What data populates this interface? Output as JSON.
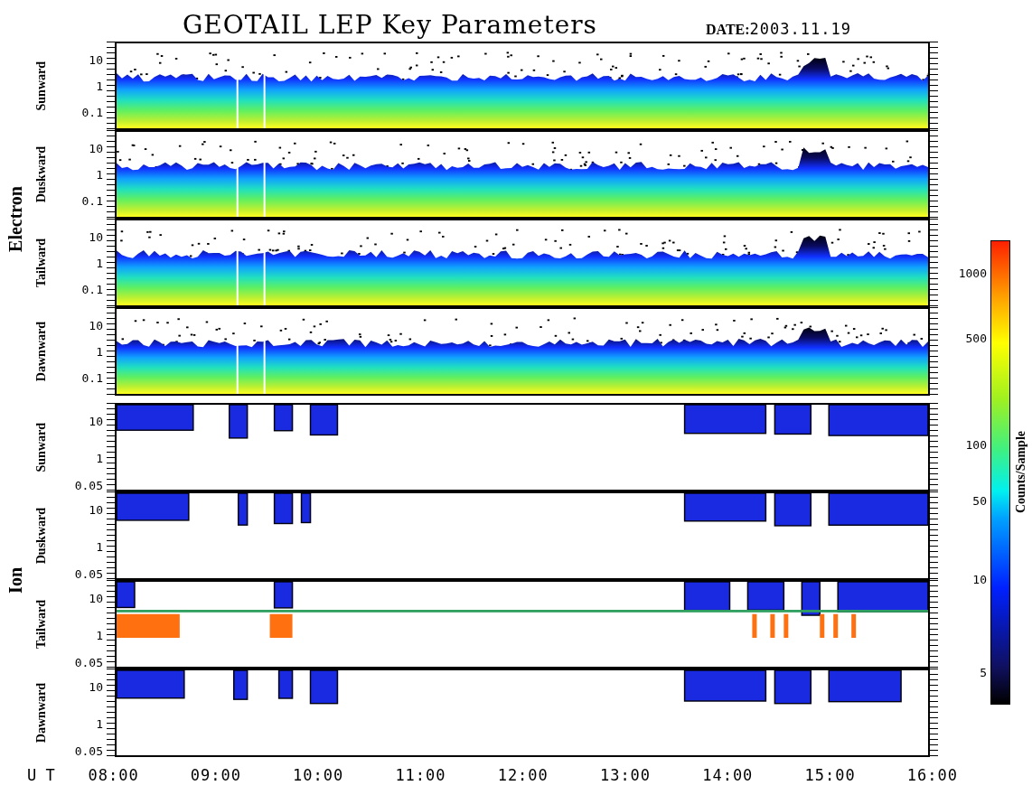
{
  "title": "GEOTAIL LEP Key Parameters",
  "date": {
    "label": "DATE:",
    "value": "2003.11.19"
  },
  "groups": [
    {
      "name": "Electron",
      "kind": "electron",
      "panels": [
        {
          "label": "Sunward",
          "yticks": [
            "10",
            "1",
            "0.1"
          ]
        },
        {
          "label": "Duskward",
          "yticks": [
            "10",
            "1",
            "0.1"
          ]
        },
        {
          "label": "Tailward",
          "yticks": [
            "10",
            "1",
            "0.1"
          ]
        },
        {
          "label": "Dawnward",
          "yticks": [
            "10",
            "1",
            "0.1"
          ]
        }
      ]
    },
    {
      "name": "Ion",
      "kind": "ion",
      "panels": [
        {
          "label": "Sunward",
          "yticks": [
            "10",
            "1",
            "0.05"
          ]
        },
        {
          "label": "Duskward",
          "yticks": [
            "10",
            "1",
            "0.05"
          ]
        },
        {
          "label": "Tailward",
          "yticks": [
            "10",
            "1",
            "0.05"
          ]
        },
        {
          "label": "Dawnward",
          "yticks": [
            "10",
            "1",
            "0.05"
          ]
        }
      ]
    }
  ],
  "time_axis": {
    "label": "U T",
    "ticks": [
      "08:00",
      "09:00",
      "10:00",
      "11:00",
      "12:00",
      "13:00",
      "14:00",
      "15:00",
      "16:00"
    ]
  },
  "colorbar": {
    "label": "Counts/Sample",
    "ticks": [
      "1000",
      "500",
      "100",
      "50",
      "10",
      "5"
    ]
  }
}
